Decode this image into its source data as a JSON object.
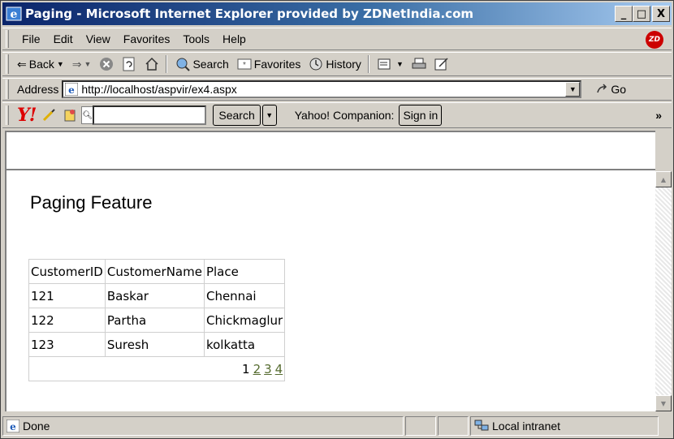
{
  "window": {
    "title": "Paging - Microsoft Internet Explorer provided by ZDNetIndia.com",
    "min_glyph": "_",
    "max_glyph": "□",
    "close_glyph": "X"
  },
  "menu": {
    "items": [
      "File",
      "Edit",
      "View",
      "Favorites",
      "Tools",
      "Help"
    ],
    "brand": "ZD"
  },
  "toolbar": {
    "back": "Back",
    "search": "Search",
    "favorites": "Favorites",
    "history": "History"
  },
  "address": {
    "label": "Address",
    "url": "http://localhost/aspvir/ex4.aspx",
    "go": "Go"
  },
  "yahoo": {
    "logo": "Y!",
    "search_button": "Search",
    "companion_label": "Yahoo! Companion:",
    "signin": "Sign in",
    "more": "»"
  },
  "page": {
    "heading": "Paging Feature",
    "grid": {
      "headers": [
        "CustomerID",
        "CustomerName",
        "Place"
      ],
      "rows": [
        [
          "121",
          "Baskar",
          "Chennai"
        ],
        [
          "122",
          "Partha",
          "Chickmaglur"
        ],
        [
          "123",
          "Suresh",
          "kolkatta"
        ]
      ],
      "pager": {
        "current": "1",
        "links": [
          "2",
          "3",
          "4"
        ]
      }
    }
  },
  "status": {
    "text": "Done",
    "zone": "Local intranet"
  }
}
